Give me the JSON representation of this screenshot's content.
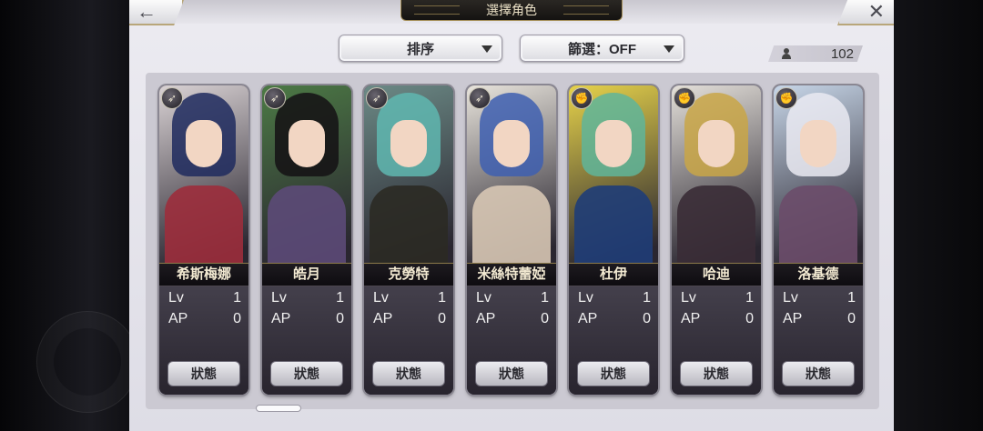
{
  "header": {
    "title": "選擇角色",
    "back_symbol": "←",
    "close_symbol": "✕"
  },
  "controls": {
    "sort_label": "排序",
    "filter_label": "篩選：OFF",
    "count": "102"
  },
  "stat_labels": {
    "lv": "Lv",
    "ap": "AP"
  },
  "status_button_label": "狀態",
  "characters": [
    {
      "name": "希斯梅娜",
      "lv": "1",
      "ap": "0",
      "icon": "bow-icon",
      "colors": {
        "hair": "#1f2a5e",
        "body": "#9c2e3c",
        "bg": "#d9d2d4"
      }
    },
    {
      "name": "皓月",
      "lv": "1",
      "ap": "0",
      "icon": "bow-icon",
      "colors": {
        "hair": "#141014",
        "body": "#5c4a78",
        "bg": "#4c7a45"
      }
    },
    {
      "name": "克勞特",
      "lv": "1",
      "ap": "0",
      "icon": "bow-icon",
      "colors": {
        "hair": "#5fb7b0",
        "body": "#2b2a24",
        "bg": "#6c8a86"
      }
    },
    {
      "name": "米絲特蕾婭",
      "lv": "1",
      "ap": "0",
      "icon": "bow-icon",
      "colors": {
        "hair": "#3e5fb0",
        "body": "#d7c7b4",
        "bg": "#e8e4dc"
      }
    },
    {
      "name": "杜伊",
      "lv": "1",
      "ap": "0",
      "icon": "fist-icon",
      "colors": {
        "hair": "#5fb59a",
        "body": "#1f3d78",
        "bg": "#e6d24a"
      }
    },
    {
      "name": "哈迪",
      "lv": "1",
      "ap": "0",
      "icon": "fist-icon",
      "colors": {
        "hair": "#c9a646",
        "body": "#3a2c36",
        "bg": "#e4e0da"
      }
    },
    {
      "name": "洛基德",
      "lv": "1",
      "ap": "0",
      "icon": "fist-icon",
      "colors": {
        "hair": "#eaeaf2",
        "body": "#6b4d6a",
        "bg": "#c7d6e8"
      }
    }
  ]
}
